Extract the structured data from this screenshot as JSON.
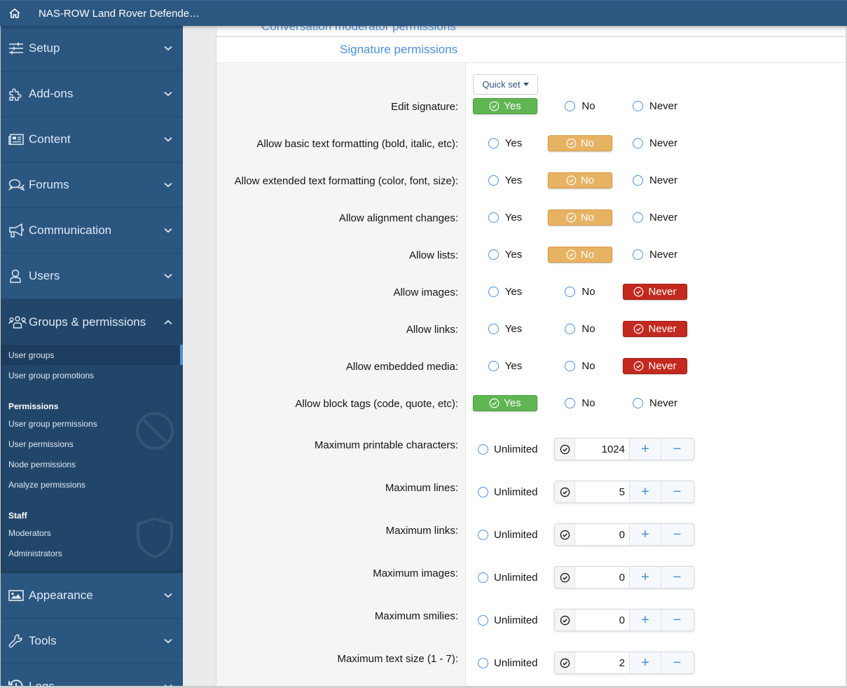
{
  "topbar": {
    "title": "NAS-ROW Land Rover Defende…",
    "home_icon": "home-icon"
  },
  "sidebar": {
    "items": [
      {
        "label": "Setup",
        "icon": "sliders-icon"
      },
      {
        "label": "Add-ons",
        "icon": "puzzle-icon"
      },
      {
        "label": "Content",
        "icon": "newspaper-icon"
      },
      {
        "label": "Forums",
        "icon": "comments-icon"
      },
      {
        "label": "Communication",
        "icon": "megaphone-icon"
      },
      {
        "label": "Users",
        "icon": "user-icon"
      },
      {
        "label": "Groups & permissions",
        "icon": "users-icon"
      },
      {
        "label": "Appearance",
        "icon": "image-icon"
      },
      {
        "label": "Tools",
        "icon": "wrench-icon"
      },
      {
        "label": "Logs",
        "icon": "history-icon"
      }
    ],
    "groups_sub": {
      "links": [
        "User groups",
        "User group promotions"
      ],
      "permissions_heading": "Permissions",
      "permission_links": [
        "User group permissions",
        "User permissions",
        "Node permissions",
        "Analyze permissions"
      ],
      "staff_heading": "Staff",
      "staff_links": [
        "Moderators",
        "Administrators"
      ]
    }
  },
  "main": {
    "previous_section": "Conversation moderator permissions",
    "section_title": "Signature permissions",
    "quick_set": "Quick set",
    "option_labels": {
      "yes": "Yes",
      "no": "No",
      "never": "Never",
      "unlimited": "Unlimited"
    },
    "permissions": [
      {
        "label": "Edit signature:",
        "value": "yes"
      },
      {
        "label": "Allow basic text formatting (bold, italic, etc):",
        "value": "no"
      },
      {
        "label": "Allow extended text formatting (color, font, size):",
        "value": "no"
      },
      {
        "label": "Allow alignment changes:",
        "value": "no"
      },
      {
        "label": "Allow lists:",
        "value": "no"
      },
      {
        "label": "Allow images:",
        "value": "never"
      },
      {
        "label": "Allow links:",
        "value": "never"
      },
      {
        "label": "Allow embedded media:",
        "value": "never"
      },
      {
        "label": "Allow block tags (code, quote, etc):",
        "value": "yes"
      }
    ],
    "limits": [
      {
        "label": "Maximum printable characters:",
        "value": "1024"
      },
      {
        "label": "Maximum lines:",
        "value": "5"
      },
      {
        "label": "Maximum links:",
        "value": "0"
      },
      {
        "label": "Maximum images:",
        "value": "0"
      },
      {
        "label": "Maximum smilies:",
        "value": "0"
      },
      {
        "label": "Maximum text size (1 - 7):",
        "value": "2"
      }
    ],
    "colors": {
      "yes": "#5fb653",
      "no": "#e8b263",
      "never": "#c3291f",
      "accent": "#4a90d9"
    }
  }
}
